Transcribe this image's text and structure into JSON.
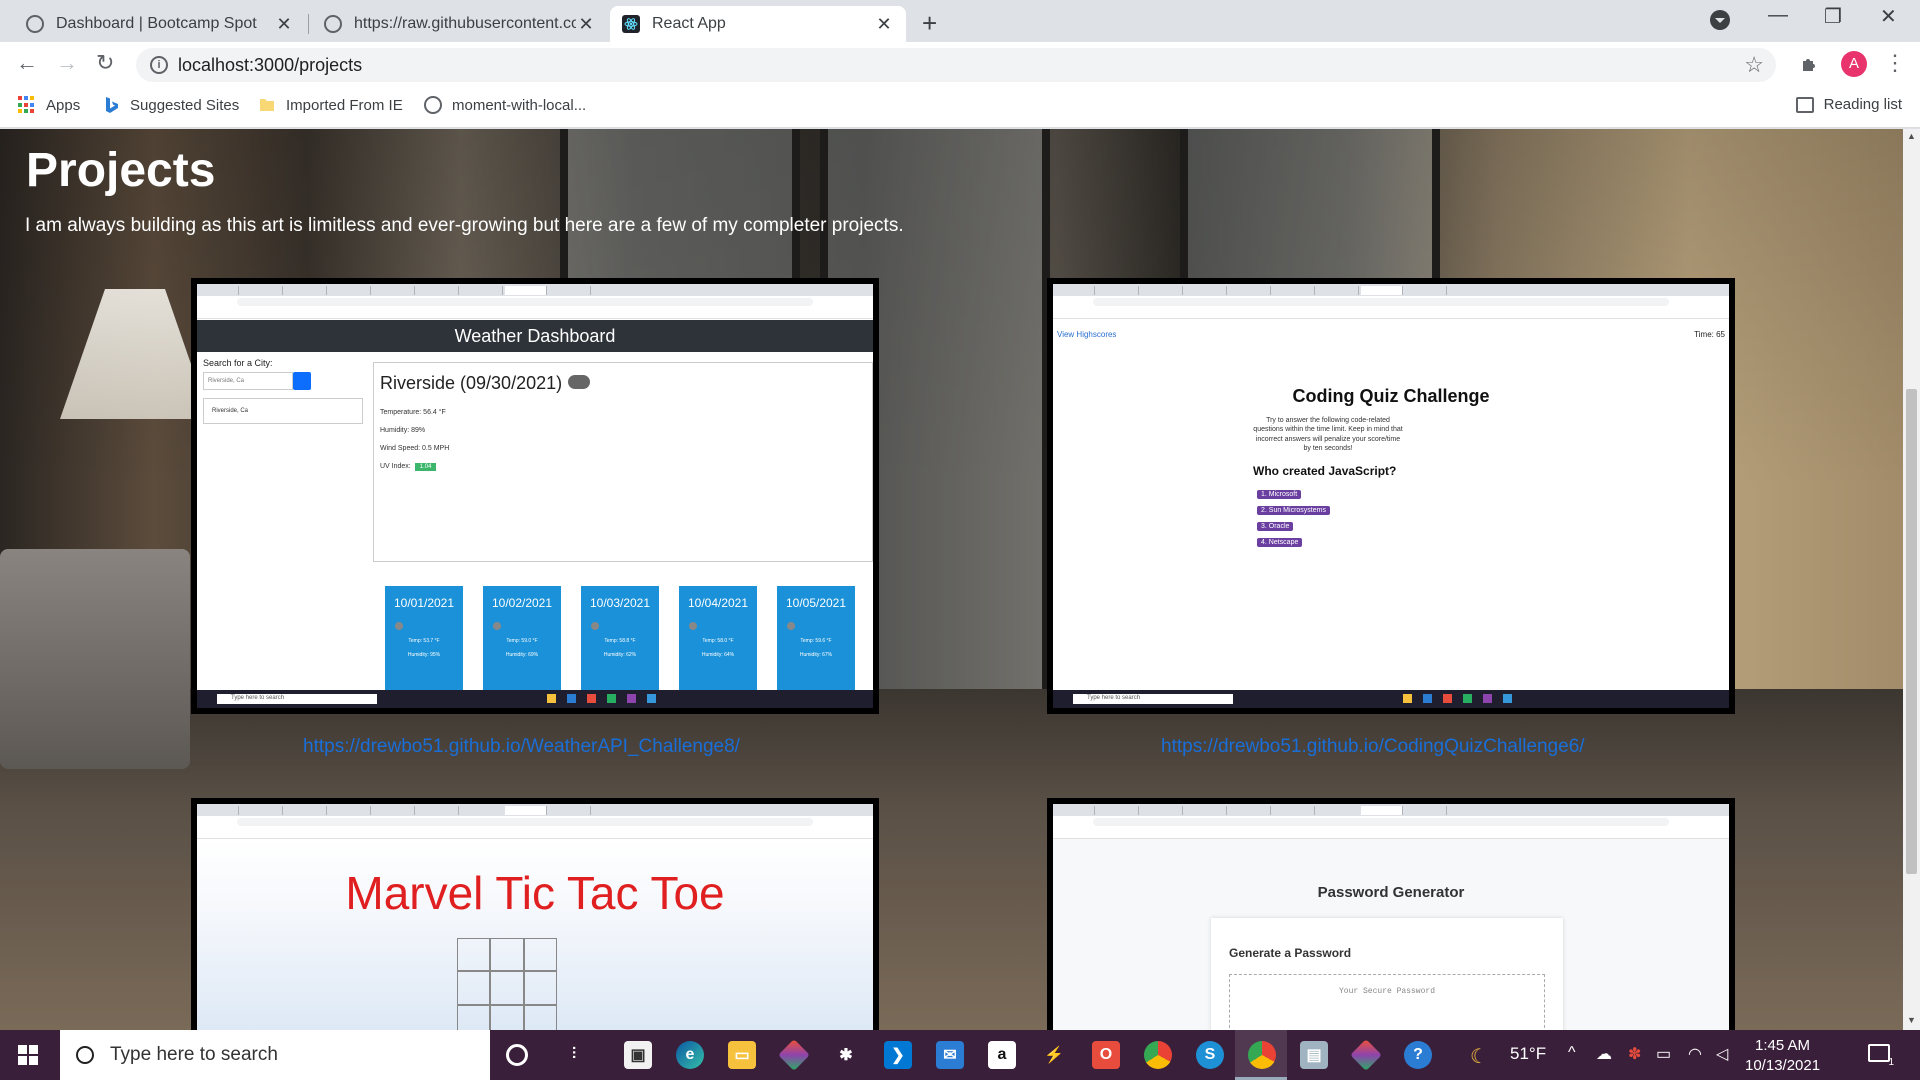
{
  "browser": {
    "tabs": [
      {
        "title": "Dashboard | Bootcamp Spot",
        "active": false
      },
      {
        "title": "https://raw.githubusercontent.co",
        "active": false
      },
      {
        "title": "React App",
        "active": true
      }
    ],
    "new_tab": "+",
    "window_controls": {
      "minimize": "—",
      "maximize": "❐",
      "close": "✕"
    },
    "url": "localhost:3000/projects",
    "avatar_letter": "A",
    "bookmarks": [
      {
        "label": "Apps",
        "icon": "apps-grid-icon"
      },
      {
        "label": "Suggested Sites",
        "icon": "bing-icon"
      },
      {
        "label": "Imported From IE",
        "icon": "folder-icon"
      },
      {
        "label": "moment-with-local...",
        "icon": "globe-icon"
      }
    ],
    "reading_list": "Reading list"
  },
  "page": {
    "title": "Projects",
    "intro": "I am always building as this art is limitless and ever-growing but here are a few of my completer projects.",
    "projects": [
      {
        "link": "https://drewbo51.github.io/WeatherAPI_Challenge8/"
      },
      {
        "link": "https://drewbo51.github.io/CodingQuizChallenge6/"
      }
    ]
  },
  "weather_shot": {
    "header": "Weather Dashboard",
    "search_label": "Search for a City:",
    "search_value": "Riverside, Ca",
    "history_item": "Riverside, Ca",
    "city_date": "Riverside (09/30/2021)",
    "temperature": "Temperature: 56.4 °F",
    "humidity": "Humidity: 89%",
    "wind": "Wind Speed: 0.5 MPH",
    "uv_label": "UV Index:",
    "uv_value": "1.04",
    "forecast": [
      {
        "date": "10/01/2021",
        "temp": "Temp: 53.7 °F",
        "humidity": "Humidity: 95%"
      },
      {
        "date": "10/02/2021",
        "temp": "Temp: 59.0 °F",
        "humidity": "Humidity: 69%"
      },
      {
        "date": "10/03/2021",
        "temp": "Temp: 58.8 °F",
        "humidity": "Humidity: 62%"
      },
      {
        "date": "10/04/2021",
        "temp": "Temp: 58.0 °F",
        "humidity": "Humidity: 64%"
      },
      {
        "date": "10/05/2021",
        "temp": "Temp: 59.6 °F",
        "humidity": "Humidity: 67%"
      }
    ],
    "taskbar_search": "Type here to search"
  },
  "quiz_shot": {
    "highscores": "View Highscores",
    "time": "Time: 65",
    "title": "Coding Quiz Challenge",
    "instructions": "Try to answer the following code-related questions within the time limit. Keep in mind that incorrect answers will penalize your score/time by ten seconds!",
    "question": "Who created JavaScript?",
    "options": [
      "1. Microsoft",
      "2. Sun Microsystems",
      "3. Oracle",
      "4. Netscape"
    ],
    "taskbar_search": "Type here to search"
  },
  "ttt_shot": {
    "title": "Marvel Tic Tac Toe"
  },
  "password_shot": {
    "title": "Password Generator",
    "card_title": "Generate a Password",
    "placeholder": "Your Secure Password"
  },
  "taskbar": {
    "search_placeholder": "Type here to search",
    "weather": "51°F",
    "time": "1:45 AM",
    "date": "10/13/2021",
    "notification_count": "1"
  }
}
